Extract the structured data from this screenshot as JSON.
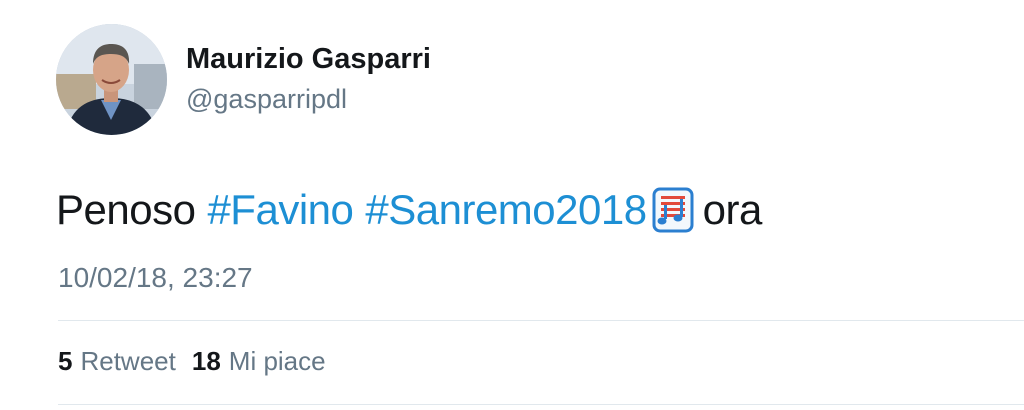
{
  "author": {
    "display_name": "Maurizio Gasparri",
    "handle": "@gasparripdl",
    "avatar_icon": "profile-photo"
  },
  "tweet": {
    "text_before": "Penoso",
    "hashtags": [
      "#Favino",
      "#Sanremo2018"
    ],
    "emoji_icon": "musical-score-emoji",
    "text_after": "ora",
    "timestamp": "10/02/18, 23:27"
  },
  "stats": {
    "retweet_count": "5",
    "retweet_label": "Retweet",
    "like_count": "18",
    "like_label": "Mi piace"
  },
  "colors": {
    "hashtag": "#1d8fd4",
    "secondary_text": "#657786",
    "primary_text": "#14171a",
    "divider": "#e1e8ed"
  }
}
